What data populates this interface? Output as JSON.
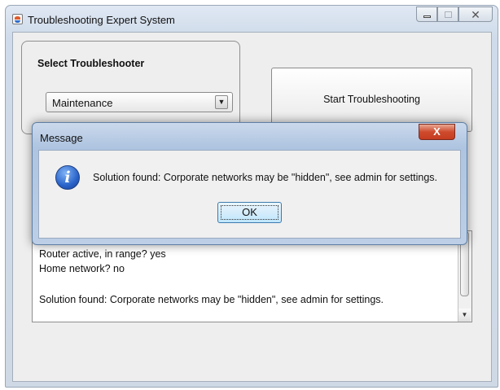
{
  "window": {
    "title": "Troubleshooting Expert System",
    "controls": {
      "minimize": "minimize",
      "maximize": "maximize",
      "close": "✕"
    }
  },
  "selector": {
    "label": "Select Troubleshooter",
    "selected": "Maintenance",
    "arrow": "▼"
  },
  "start_button": "Start Troubleshooting",
  "log": {
    "lines": [
      "Router active, in range? yes",
      "Home network? no",
      "",
      "Solution found: Corporate networks may be \"hidden\", see admin for settings."
    ],
    "scroll_arrow": "▼"
  },
  "dialog": {
    "title": "Message",
    "close": "X",
    "icon": "i",
    "message": "Solution found: Corporate networks may be \"hidden\", see admin for settings.",
    "ok": "OK"
  }
}
